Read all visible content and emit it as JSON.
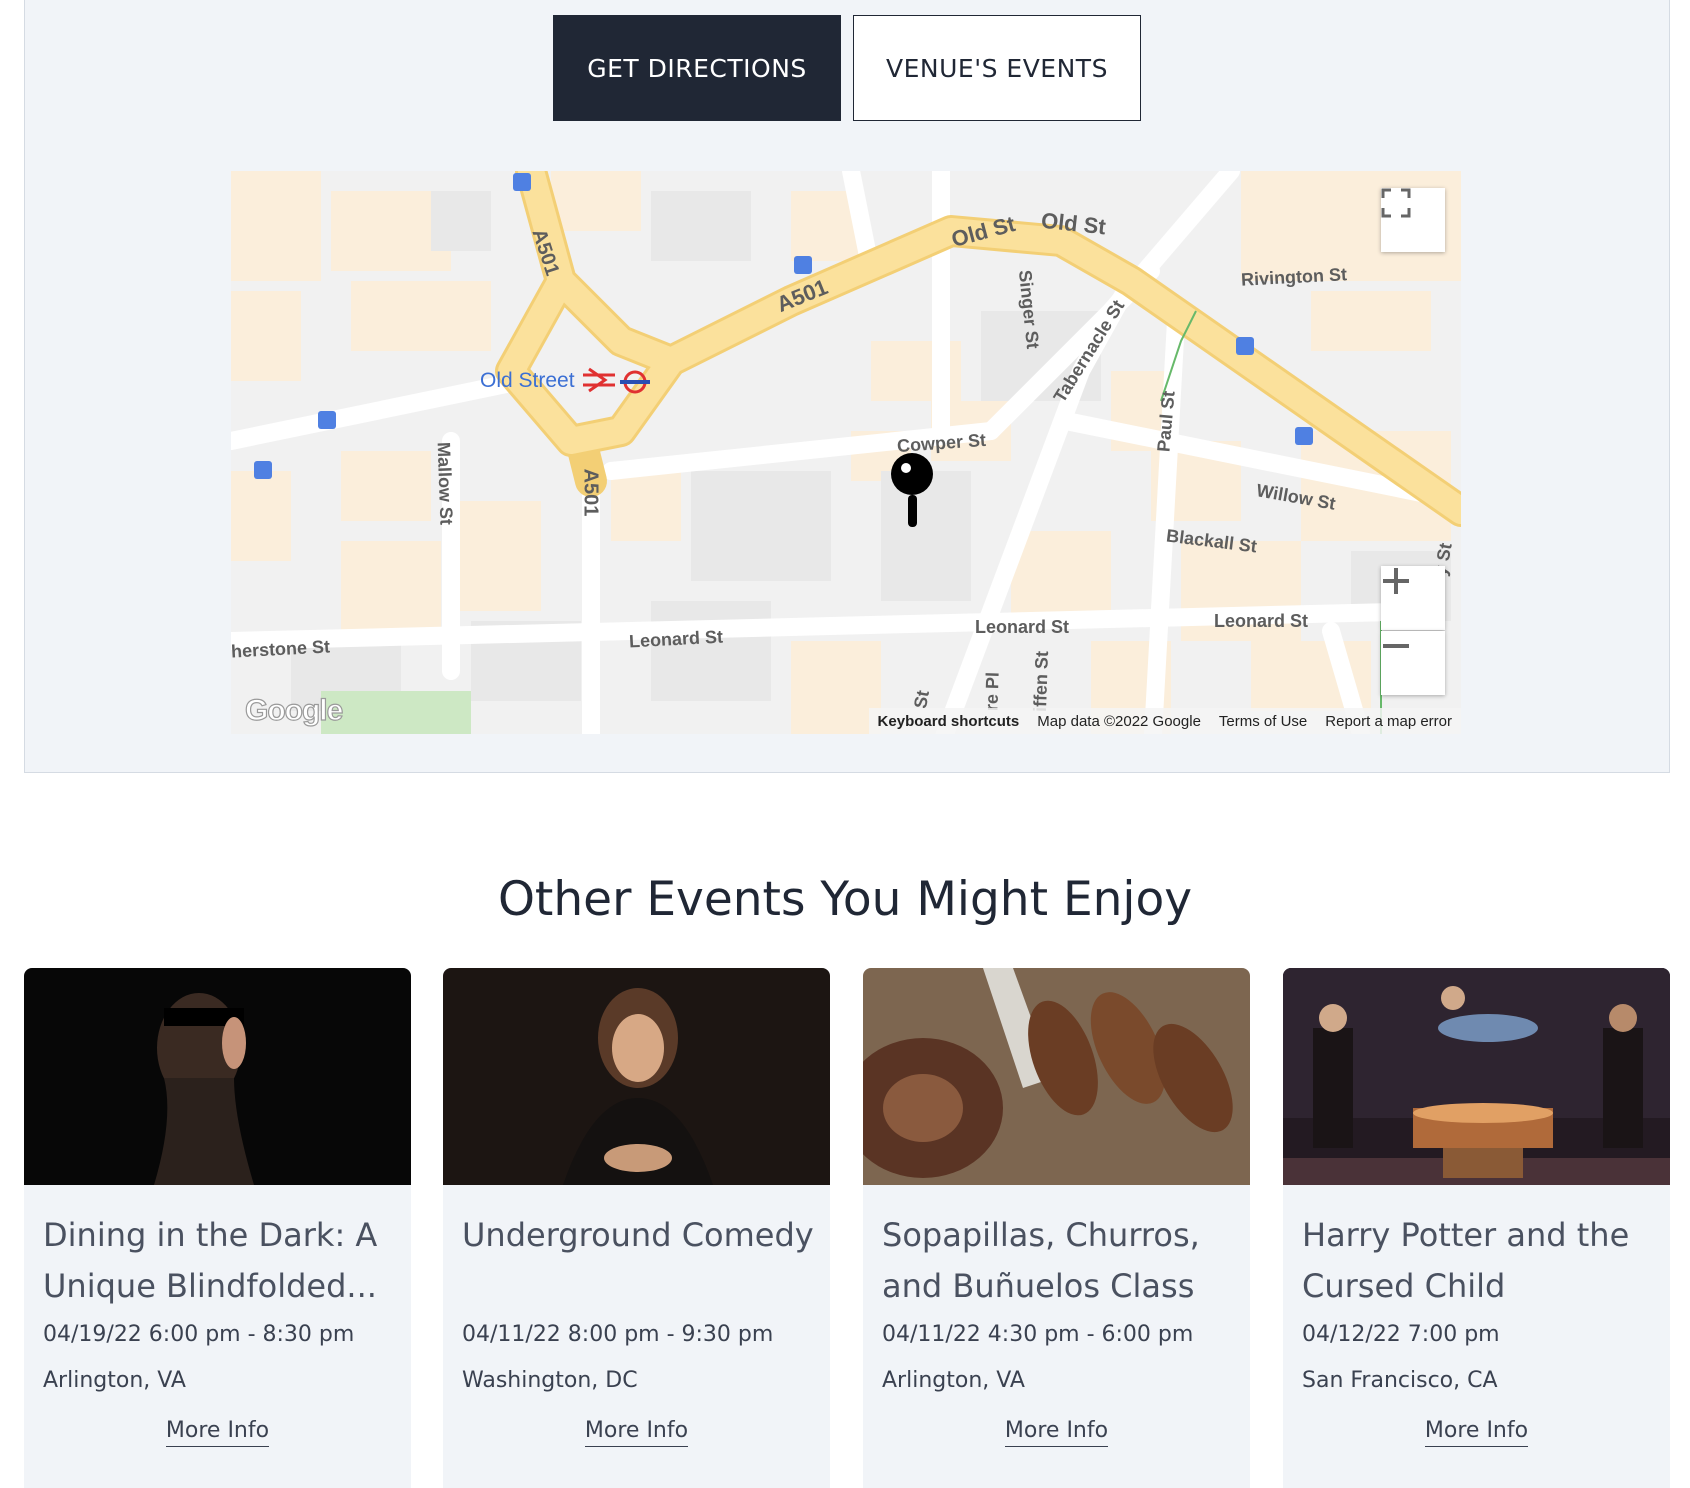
{
  "venue": {
    "get_directions_label": "GET DIRECTIONS",
    "venues_events_label": "VENUE'S EVENTS"
  },
  "map": {
    "streets": {
      "old_st_1": "Old St",
      "old_st_2": "Old St",
      "a501_1": "A501",
      "a501_2": "A501",
      "a501_3": "A501",
      "rivington_st": "Rivington St",
      "singer_st": "Singer St",
      "tabernacle_st": "Tabernacle St",
      "paul_st": "Paul St",
      "cowper_st": "Cowper St",
      "willow_st": "Willow St",
      "blackall_st": "Blackall St",
      "mallow_st": "Mallow St",
      "leonard_st_1": "Leonard St",
      "leonard_st_2": "Leonard St",
      "leonard_st_3": "Leonard St",
      "featherstone_st": "herstone St",
      "station": "Old Street",
      "ruffen_st": "iffen St",
      "crane_pl": "re Pl",
      "st_fragment": "St",
      "y_st": "y St"
    },
    "google_logo": "Google",
    "footer": {
      "keyboard_shortcuts": "Keyboard shortcuts",
      "map_data": "Map data ©2022 Google",
      "terms": "Terms of Use",
      "report": "Report a map error"
    },
    "icons": {
      "fullscreen": "fullscreen-icon",
      "zoom_in": "plus-icon",
      "zoom_out": "minus-icon",
      "marker": "map-pin-icon",
      "bus": "bus-stop-icon",
      "rail": "rail-icon",
      "underground": "underground-icon"
    }
  },
  "other_events": {
    "title": "Other Events You Might Enjoy",
    "cards": [
      {
        "title": "Dining in the Dark: A Unique Blindfolded...",
        "date": "04/19/22 6:00 pm - 8:30 pm",
        "location": "Arlington, VA",
        "more": "More Info"
      },
      {
        "title": "Underground Comedy",
        "date": "04/11/22 8:00 pm - 9:30 pm",
        "location": "Washington, DC",
        "more": "More Info"
      },
      {
        "title": "Sopapillas, Churros, and Buñuelos Class",
        "date": "04/11/22 4:30 pm - 6:00 pm",
        "location": "Arlington, VA",
        "more": "More Info"
      },
      {
        "title": "Harry Potter and the Cursed Child",
        "date": "04/12/22 7:00 pm",
        "location": "San Francisco, CA",
        "more": "More Info"
      }
    ]
  },
  "colors": {
    "dark_button": "#202735",
    "panel_bg": "#f1f4f8",
    "major_road": "#f8d888",
    "building": "#fbeedb"
  }
}
